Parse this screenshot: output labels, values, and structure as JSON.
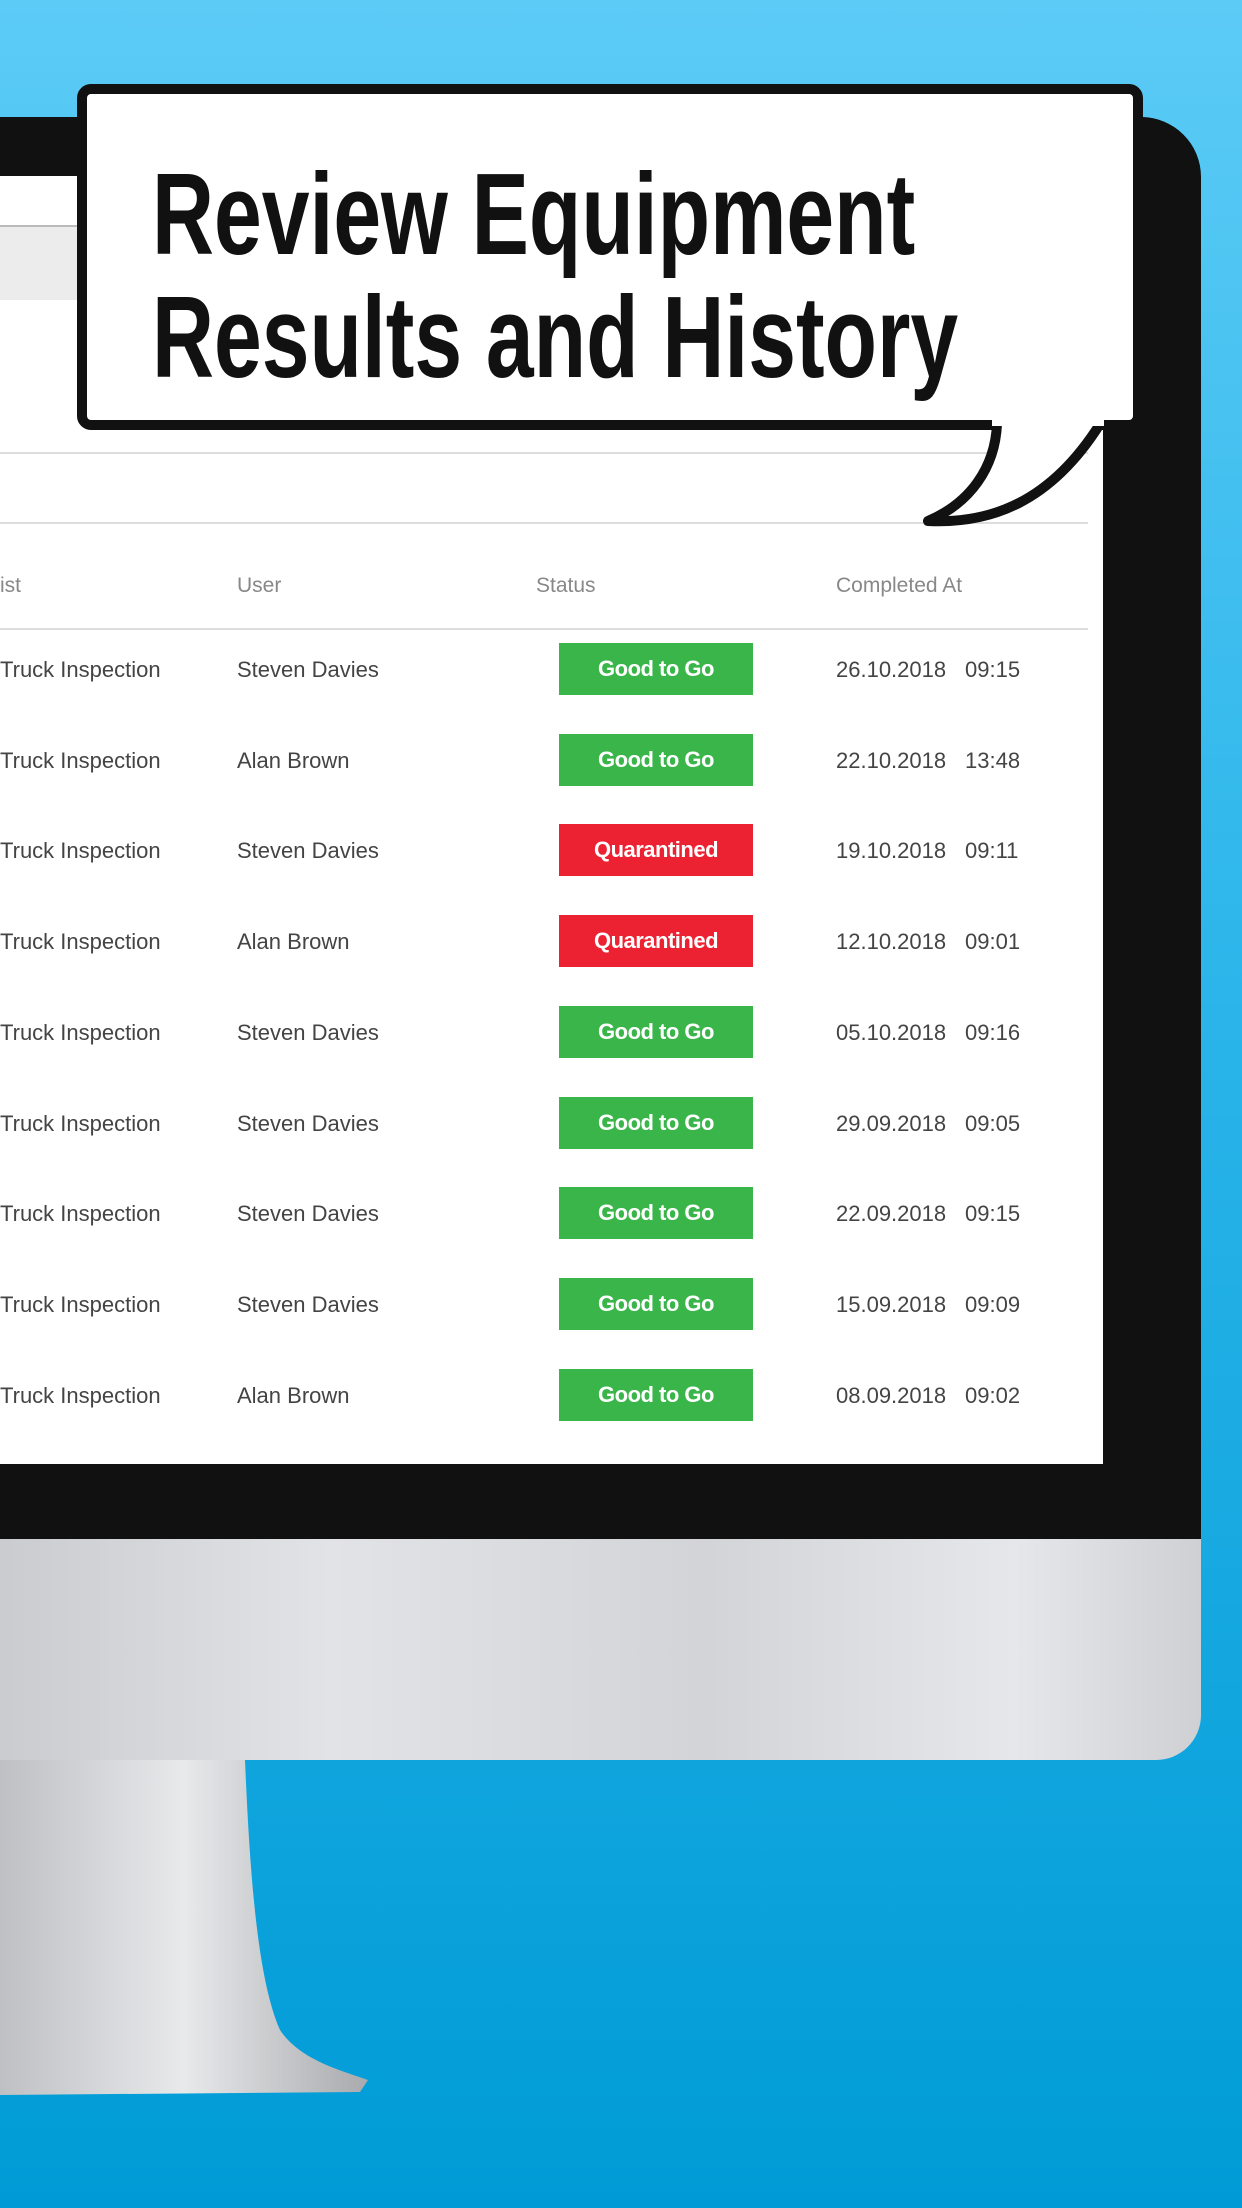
{
  "headline": {
    "line1": "Review Equipment",
    "line2": "Results and History"
  },
  "table": {
    "headers": {
      "checklist": "ist",
      "user": "User",
      "status": "Status",
      "completed": "Completed At"
    },
    "rows": [
      {
        "checklist": "Truck Inspection",
        "user": "Steven Davies",
        "status": "Good to Go",
        "date": "26.10.2018",
        "time": "09:15"
      },
      {
        "checklist": "Truck Inspection",
        "user": "Alan Brown",
        "status": "Good to Go",
        "date": "22.10.2018",
        "time": "13:48"
      },
      {
        "checklist": "Truck Inspection",
        "user": "Steven Davies",
        "status": "Quarantined",
        "date": "19.10.2018",
        "time": "09:11"
      },
      {
        "checklist": "Truck Inspection",
        "user": "Alan Brown",
        "status": "Quarantined",
        "date": "12.10.2018",
        "time": "09:01"
      },
      {
        "checklist": "Truck Inspection",
        "user": "Steven Davies",
        "status": "Good to Go",
        "date": "05.10.2018",
        "time": "09:16"
      },
      {
        "checklist": "Truck Inspection",
        "user": "Steven Davies",
        "status": "Good to Go",
        "date": "29.09.2018",
        "time": "09:05"
      },
      {
        "checklist": "Truck Inspection",
        "user": "Steven Davies",
        "status": "Good to Go",
        "date": "22.09.2018",
        "time": "09:15"
      },
      {
        "checklist": "Truck Inspection",
        "user": "Steven Davies",
        "status": "Good to Go",
        "date": "15.09.2018",
        "time": "09:09"
      },
      {
        "checklist": "Truck Inspection",
        "user": "Alan Brown",
        "status": "Good to Go",
        "date": "08.09.2018",
        "time": "09:02"
      }
    ]
  },
  "colors": {
    "good": "#3ab54a",
    "quarantined": "#ec2232",
    "background": "#1fb0e8"
  }
}
